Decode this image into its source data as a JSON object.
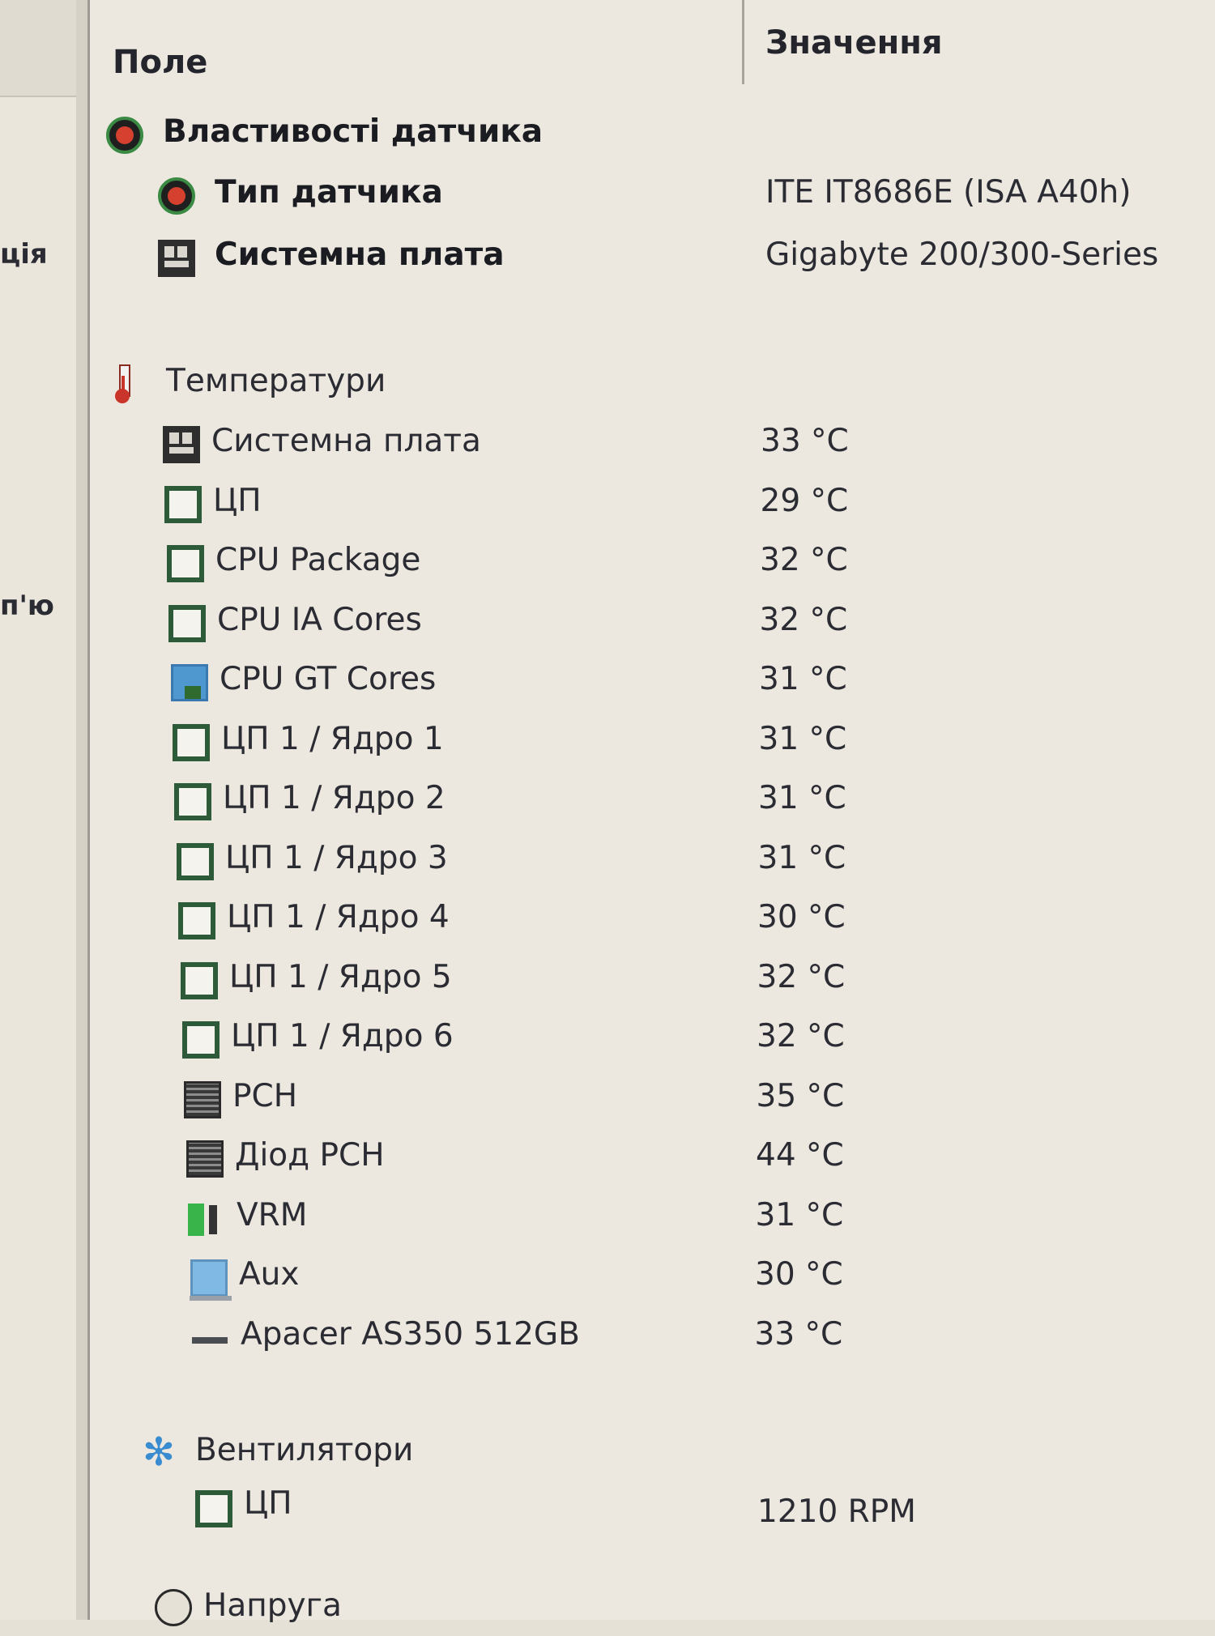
{
  "left_pane": {
    "fragment_1": "ція",
    "fragment_2": "п'ю"
  },
  "columns": {
    "field": "Поле",
    "value": "Значення"
  },
  "sensor_props": {
    "title": "Властивості датчика",
    "rows": [
      {
        "label": "Тип датчика",
        "value": "ITE IT8686E  (ISA A40h)",
        "icon": "sensor-icon"
      },
      {
        "label": "Системна плата",
        "value": "Gigabyte 200/300-Series",
        "icon": "motherboard-icon"
      }
    ]
  },
  "temperatures": {
    "title": "Температури",
    "rows": [
      {
        "label": "Системна плата",
        "value": "33 °C",
        "icon": "motherboard-icon"
      },
      {
        "label": "ЦП",
        "value": "29 °C",
        "icon": "cpu-icon"
      },
      {
        "label": "CPU Package",
        "value": "32 °C",
        "icon": "cpu-icon"
      },
      {
        "label": "CPU IA Cores",
        "value": "32 °C",
        "icon": "cpu-icon"
      },
      {
        "label": "CPU GT Cores",
        "value": "31 °C",
        "icon": "gpu-icon"
      },
      {
        "label": "ЦП 1 / Ядро 1",
        "value": "31 °C",
        "icon": "cpu-icon"
      },
      {
        "label": "ЦП 1 / Ядро 2",
        "value": "31 °C",
        "icon": "cpu-icon"
      },
      {
        "label": "ЦП 1 / Ядро 3",
        "value": "31 °C",
        "icon": "cpu-icon"
      },
      {
        "label": "ЦП 1 / Ядро 4",
        "value": "30 °C",
        "icon": "cpu-icon"
      },
      {
        "label": "ЦП 1 / Ядро 5",
        "value": "32 °C",
        "icon": "cpu-icon"
      },
      {
        "label": "ЦП 1 / Ядро 6",
        "value": "32 °C",
        "icon": "cpu-icon"
      },
      {
        "label": "PCH",
        "value": "35 °C",
        "icon": "chipset-icon"
      },
      {
        "label": "Діод PCH",
        "value": "44 °C",
        "icon": "chipset-icon"
      },
      {
        "label": "VRM",
        "value": "31 °C",
        "icon": "vrm-icon"
      },
      {
        "label": "Aux",
        "value": "30 °C",
        "icon": "monitor-icon"
      },
      {
        "label": "Apacer AS350 512GB",
        "value": "33 °C",
        "icon": "drive-icon"
      }
    ]
  },
  "fans": {
    "title": "Вентилятори",
    "rows": [
      {
        "label": "ЦП",
        "value": "1210 RPM",
        "icon": "cpu-icon"
      }
    ]
  },
  "voltage": {
    "title": "Напруга"
  }
}
